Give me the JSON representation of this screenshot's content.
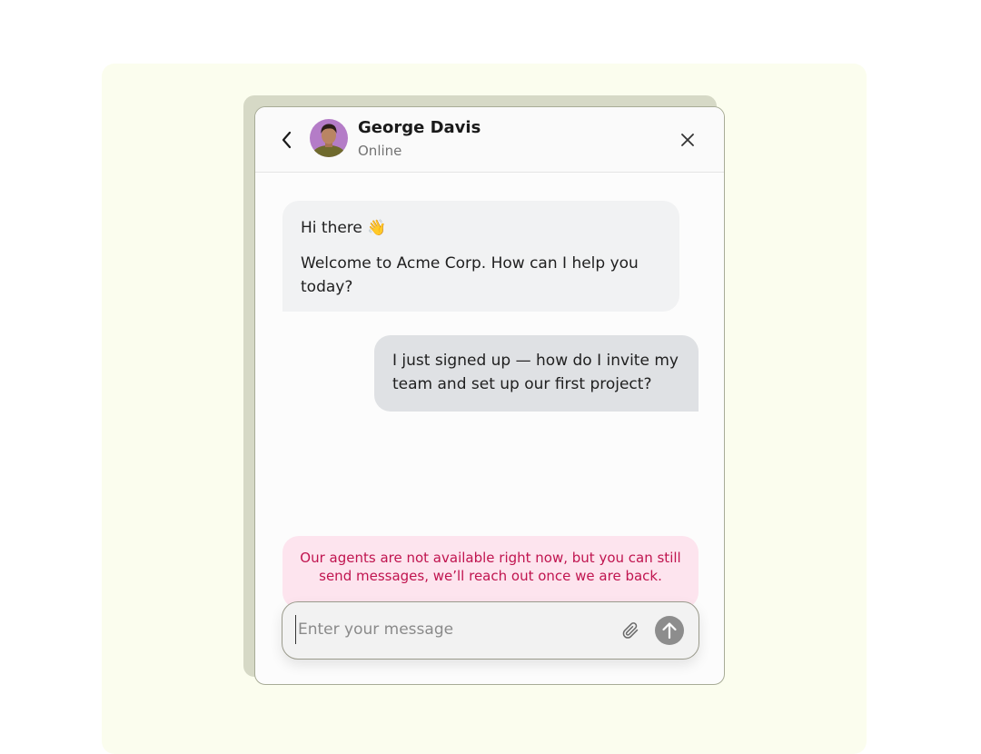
{
  "header": {
    "agent_name": "George Davis",
    "agent_status": "Online",
    "back_icon": "chevron-left-icon",
    "close_icon": "close-icon"
  },
  "messages": [
    {
      "sender": "agent",
      "lines": [
        "Hi there 👋",
        "Welcome to Acme Corp. How can I help you today?"
      ]
    },
    {
      "sender": "user",
      "text": "I just signed up — how do I invite my team and set up our first project?"
    }
  ],
  "notice": {
    "text": "Our agents are not available right now, but you can still send messages, we’ll reach out once we are back."
  },
  "composer": {
    "value": "",
    "placeholder": "Enter your message",
    "attach_icon": "paperclip-icon",
    "send_icon": "arrow-up-icon"
  },
  "colors": {
    "backdrop": "#fbfdee",
    "notice_text": "#c0144f",
    "notice_bg": "#fde4ee",
    "send_button": "#8d8d8d"
  }
}
